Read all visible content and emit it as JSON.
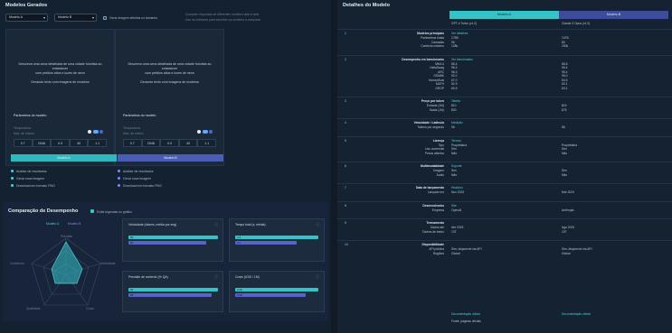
{
  "left": {
    "title": "Modelos Gerados",
    "select_a": "Modelo A",
    "select_b": "Modelo B",
    "checkbox_label": "Gerar imagem idêntica no tamanho",
    "hint_line1": "Compare respostas de diferentes modelos lado a lado",
    "hint_line2": "Use os seletores para escolher os modelos a comparar",
    "card_a": {
      "text1": "Descreva uma cena detalhada de uma cidade futurista ao entardecer",
      "text2": "com prédios altos e luzes de neon",
      "text3": "Gerando texto com imagens de modelos",
      "lbl": "Parâmetros do modelo",
      "note1": "Temperatura",
      "note2": "Máx. de tokens",
      "stats": [
        "0.7",
        "2048",
        "0.9",
        "40",
        "1.1"
      ],
      "button": "Modelo A"
    },
    "card_b": {
      "text1": "Descreva uma cena detalhada de uma cidade futurista ao entardecer",
      "text2": "com prédios altos e luzes de neon",
      "text3": "Gerando texto com imagens de modelos",
      "lbl": "Parâmetros do modelo",
      "note1": "Temperatura",
      "note2": "Máx. de tokens",
      "stats": [
        "0.7",
        "2048",
        "0.9",
        "40",
        "1.1"
      ],
      "button": "Modelo B"
    },
    "list_a": [
      "Análise de resultados",
      "Gerar nova imagem",
      "Download em formato PNG"
    ],
    "list_b": [
      "Análise de resultados",
      "Gerar nova imagem",
      "Download em formato PNG"
    ],
    "bottom_title": "Comparação de Desempenho",
    "bottom_toggle": "Exibir legendas no gráfico",
    "radar_legend": [
      "Modelo A",
      "Modelo B"
    ],
    "radar_axes": [
      "Precisão",
      "Velocidade",
      "Custo",
      "Qualidade",
      "Coerência"
    ],
    "metrics": [
      {
        "title": "Velocidade (tokens, média por seg)",
        "a": "96",
        "b": "86"
      },
      {
        "title": "Tempo total (s, média)",
        "a": "4.2",
        "b": "3.1"
      },
      {
        "title": "Precisão de contexto (% QA)",
        "a": "92",
        "b": "88"
      },
      {
        "title": "Custo (USD / 1M)",
        "a": "0.45",
        "b": "0.38"
      }
    ]
  },
  "right": {
    "title": "Detalhes do Modelo",
    "col_a": "Modelo A",
    "col_b": "Modelo B",
    "sub_a": "GPT-4 Turbo (v1.2)",
    "sub_b": "Claude 3 Opus (v1.0)",
    "sections": [
      {
        "num": "1",
        "label": "Modelos principais",
        "rows": [
          {
            "k": "Parâmetros totais",
            "a": "175B",
            "b": "137B"
          },
          {
            "k": "Camadas",
            "a": "96",
            "b": "80"
          },
          {
            "k": "Contexto máximo",
            "a": "128k",
            "b": "200k"
          }
        ],
        "tag": "Ver detalhes"
      },
      {
        "num": "2",
        "label": "Desempenho em benchmarks",
        "rows": [
          {
            "k": "MMLU",
            "a": "86.4",
            "b": "86.8"
          },
          {
            "k": "HellaSwag",
            "a": "95.3",
            "b": "95.4"
          },
          {
            "k": "ARC",
            "a": "96.3",
            "b": "96.4"
          },
          {
            "k": "GSM8K",
            "a": "92.0",
            "b": "95.0"
          },
          {
            "k": "HumanEval",
            "a": "67.0",
            "b": "84.9"
          },
          {
            "k": "MATH",
            "a": "52.9",
            "b": "60.1"
          },
          {
            "k": "DROP",
            "a": "80.9",
            "b": "83.1"
          }
        ],
        "tag": "Ver benchmarks"
      },
      {
        "num": "3",
        "label": "Preço por token",
        "rows": [
          {
            "k": "Entrada (1M)",
            "a": "$10",
            "b": "$15"
          },
          {
            "k": "Saída (1M)",
            "a": "$30",
            "b": "$75"
          }
        ],
        "tag": "Tabela"
      },
      {
        "num": "4",
        "label": "Velocidade / Latência",
        "rows": [
          {
            "k": "Tokens por segundo",
            "a": "96",
            "b": "86"
          }
        ],
        "tag": "Medição"
      },
      {
        "num": "5",
        "label": "Licença",
        "rows": [
          {
            "k": "Tipo",
            "a": "Proprietária",
            "b": "Proprietária"
          },
          {
            "k": "Uso comercial",
            "a": "Sim",
            "b": "Sim"
          },
          {
            "k": "Pesos abertos",
            "a": "Não",
            "b": "Não"
          }
        ],
        "tag": "Termos"
      },
      {
        "num": "6",
        "label": "Multimodalidade",
        "rows": [
          {
            "k": "Imagem",
            "a": "Sim",
            "b": "Sim"
          },
          {
            "k": "Áudio",
            "a": "Não",
            "b": "Não"
          }
        ],
        "tag": "Suporte"
      },
      {
        "num": "7",
        "label": "Data de lançamento",
        "rows": [
          {
            "k": "Lançado em",
            "a": "Nov 2023",
            "b": "Mar 2024"
          }
        ],
        "tag": "Histórico"
      },
      {
        "num": "8",
        "label": "Desenvolvedor",
        "rows": [
          {
            "k": "Empresa",
            "a": "OpenAI",
            "b": "Anthropic"
          }
        ],
        "tag": "Site"
      },
      {
        "num": "9",
        "label": "Treinamento",
        "rows": [
          {
            "k": "Dados até",
            "a": "Abr 2023",
            "b": "Ago 2023"
          },
          {
            "k": "Tokens de treino",
            "a": "13T",
            "b": "10T"
          }
        ],
        "tag": ""
      },
      {
        "num": "10",
        "label": "Disponibilidade",
        "rows": [
          {
            "k": "API pública",
            "a": "Sim, disponível via API",
            "b": "Sim, disponível via API"
          },
          {
            "k": "Regiões",
            "a": "Global",
            "b": "Global"
          }
        ],
        "tag": ""
      }
    ],
    "footer_a": "Documentação oficial",
    "footer_b": "Documentação oficial",
    "footer_note": "Fonte: páginas oficiais"
  },
  "colors": {
    "teal": "#36c3c8",
    "indigo": "#5a63c8",
    "bg": "#142130"
  }
}
